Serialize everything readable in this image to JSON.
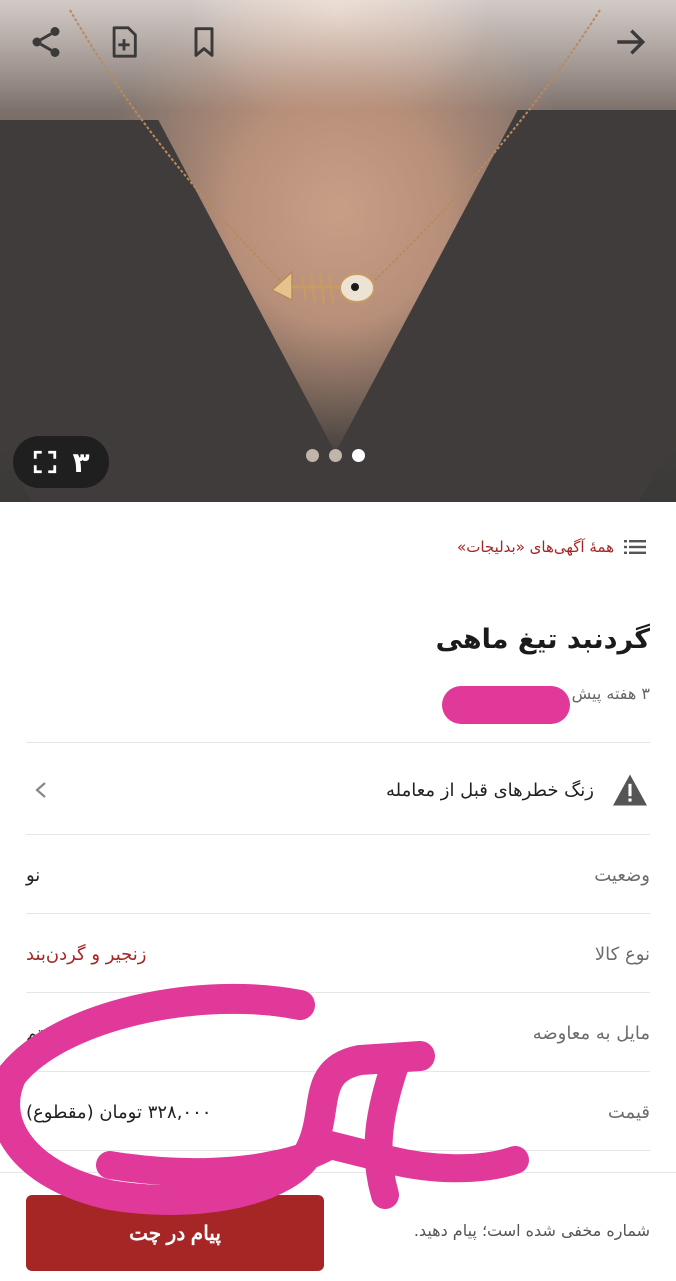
{
  "gallery": {
    "image_count": "۳",
    "slide_count": 3,
    "active_slide": 3
  },
  "toolbar": {
    "icons": [
      "share-icon",
      "add-note-icon",
      "bookmark-icon",
      "back-arrow-icon"
    ]
  },
  "breadcrumb": {
    "text": "همهٔ آگهی‌های «بدلیجات»"
  },
  "ad": {
    "title": "گردنبد تیغ ماهی",
    "time": "۳ هفته پیش"
  },
  "alert": {
    "label": "زنگ خطرهای قبل از معامله"
  },
  "attributes": [
    {
      "key": "وضعیت",
      "value": "نو"
    },
    {
      "key": "نوع کالا",
      "value": "زنجیر و گردن‌بند"
    },
    {
      "key": "مایل به معاوضه",
      "value": "نیستم"
    },
    {
      "key": "قیمت",
      "value": "۳۲۸,۰۰۰ تومان (مقطوع)"
    }
  ],
  "bottom": {
    "hint": "شماره مخفی شده است؛ پیام دهید.",
    "chat_button": "پیام در چت"
  },
  "colors": {
    "accent": "#a62626",
    "scribble": "#e0399a"
  }
}
